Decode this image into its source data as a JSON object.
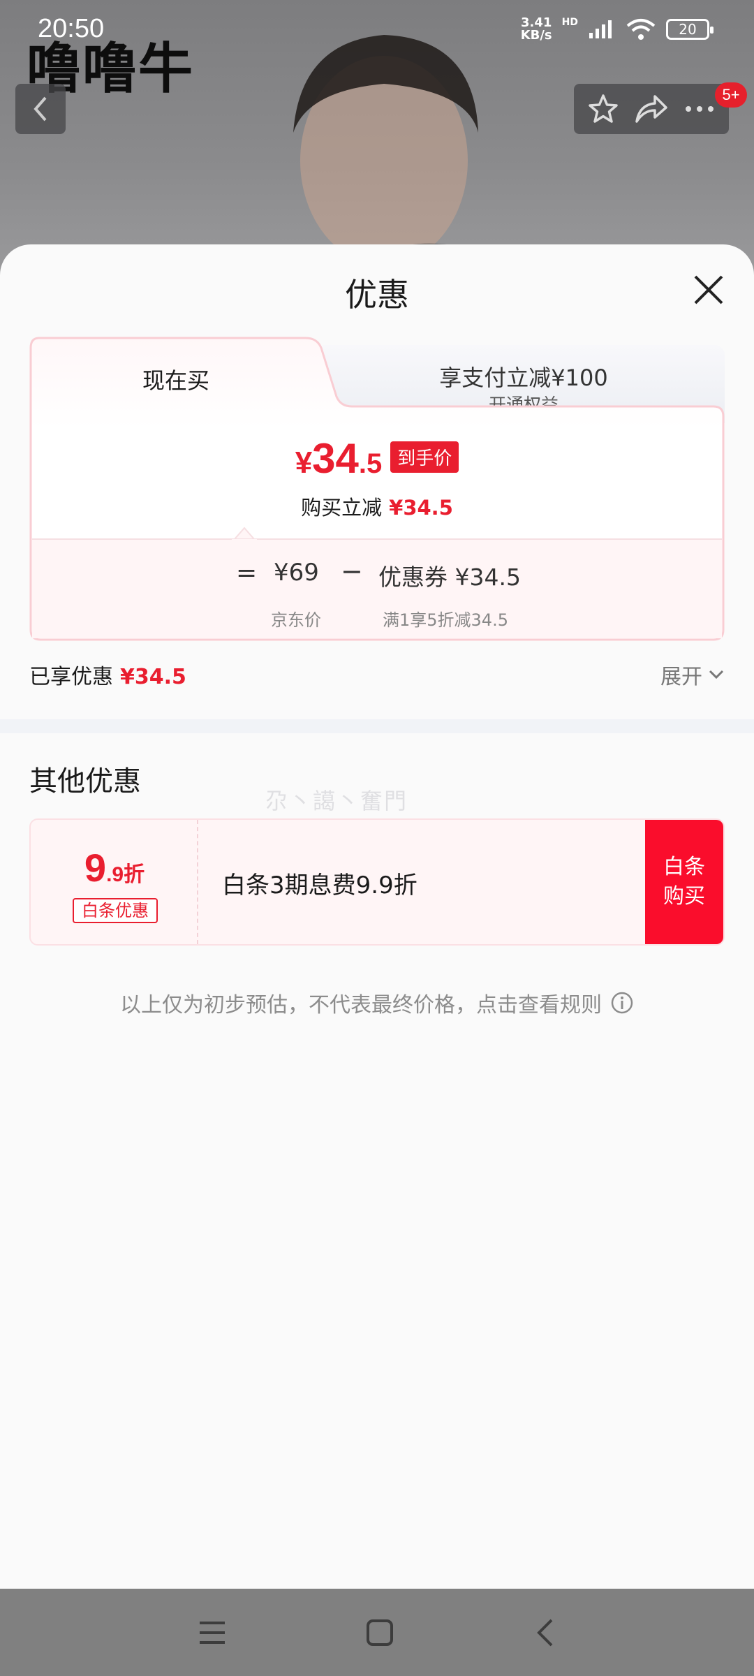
{
  "status_bar": {
    "time": "20:50",
    "net_speed_value": "3.41",
    "net_speed_unit": "KB/s",
    "hd_label": "HD",
    "battery": "20"
  },
  "watermark": "噜噜牛",
  "top_nav": {
    "cart_badge": "5+"
  },
  "sheet": {
    "title": "优惠",
    "tabs": [
      {
        "label": "现在买",
        "active": true
      },
      {
        "label": "享支付立减¥100",
        "sub": "开通权益",
        "active": false
      }
    ],
    "final_price": {
      "currency": "¥",
      "integer": "34",
      "decimal": ".5",
      "tag": "到手价"
    },
    "reduce_label": "购买立减",
    "reduce_value": "¥34.5",
    "calc": {
      "equals": "=",
      "jd_price": "¥69",
      "jd_label": "京东价",
      "minus": "−",
      "coupon": "优惠券 ¥34.5",
      "coupon_desc": "满1享5折减34.5"
    },
    "enjoyed_label": "已享优惠",
    "enjoyed_value": "¥34.5",
    "expand_label": "展开",
    "other_title": "其他优惠",
    "faint_watermark": "尕丶譪丶奮門",
    "other_offer": {
      "discount_int": "9",
      "discount_dec": ".9折",
      "badge": "白条优惠",
      "description": "白条3期息费9.9折",
      "button_line1": "白条",
      "button_line2": "购买"
    },
    "disclaimer": "以上仅为初步预估，不代表最终价格，点击查看规则"
  },
  "colors": {
    "accent_red": "#e91e2f",
    "button_red": "#fa0d2c"
  }
}
